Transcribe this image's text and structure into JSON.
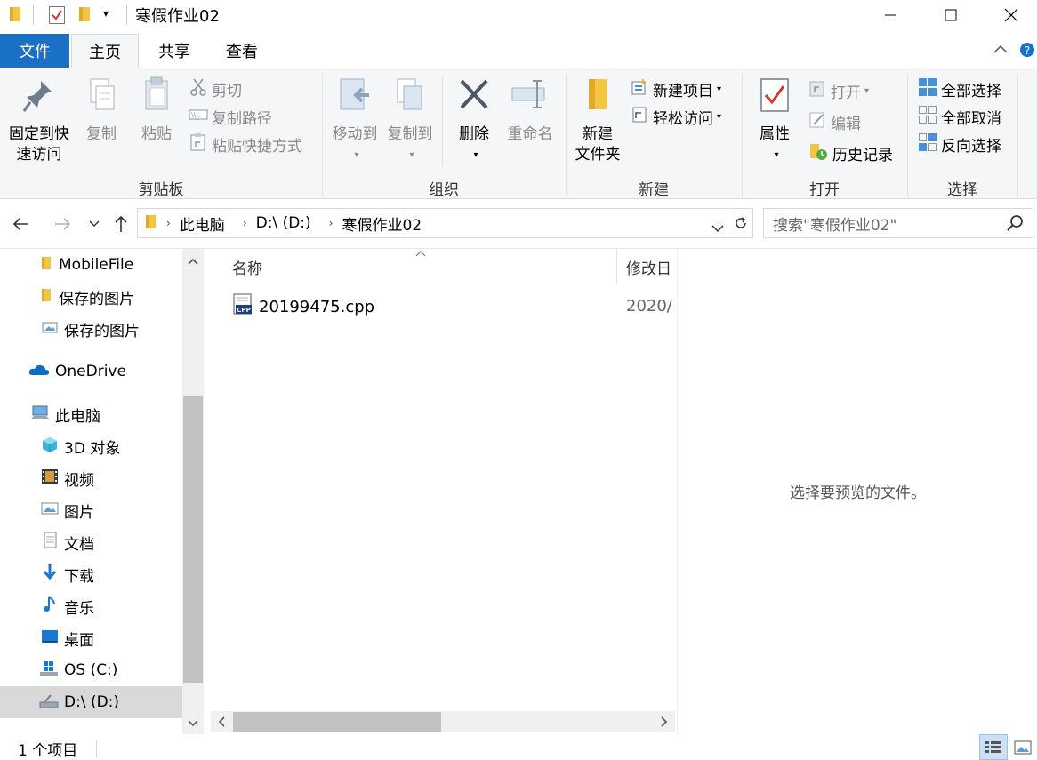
{
  "window": {
    "title": "寒假作业02",
    "controls": {
      "minimize": "—",
      "maximize": "☐",
      "close": "✕"
    }
  },
  "ribbon_tabs": [
    {
      "label": "文件"
    },
    {
      "label": "主页"
    },
    {
      "label": "共享"
    },
    {
      "label": "查看"
    }
  ],
  "ribbon": {
    "clipboard": {
      "group_label": "剪贴板",
      "pin_line1": "固定到快",
      "pin_line2": "速访问",
      "copy": "复制",
      "paste": "粘贴",
      "cut": "剪切",
      "copy_path": "复制路径",
      "paste_shortcut": "粘贴快捷方式"
    },
    "organize": {
      "group_label": "组织",
      "move_to": "移动到",
      "copy_to": "复制到",
      "delete": "删除",
      "rename": "重命名"
    },
    "new": {
      "group_label": "新建",
      "new_folder_line1": "新建",
      "new_folder_line2": "文件夹",
      "new_item": "新建项目",
      "easy_access": "轻松访问"
    },
    "open": {
      "group_label": "打开",
      "properties": "属性",
      "open": "打开",
      "edit": "编辑",
      "history": "历史记录"
    },
    "select": {
      "group_label": "选择",
      "select_all": "全部选择",
      "select_none": "全部取消",
      "invert": "反向选择"
    }
  },
  "address": {
    "segments": [
      "此电脑",
      "D:\\ (D:)",
      "寒假作业02"
    ],
    "search_placeholder": "搜索\"寒假作业02\""
  },
  "nav_pane": {
    "items": [
      {
        "label": "MobileFile"
      },
      {
        "label": "保存的图片"
      },
      {
        "label": "保存的图片"
      },
      {
        "label": "OneDrive"
      },
      {
        "label": "此电脑"
      },
      {
        "label": "3D 对象"
      },
      {
        "label": "视频"
      },
      {
        "label": "图片"
      },
      {
        "label": "文档"
      },
      {
        "label": "下载"
      },
      {
        "label": "音乐"
      },
      {
        "label": "桌面"
      },
      {
        "label": "OS (C:)"
      },
      {
        "label": "D:\\ (D:)"
      }
    ]
  },
  "file_list": {
    "columns": [
      "名称",
      "修改日"
    ],
    "files": [
      {
        "name": "20199475.cpp",
        "modified": "2020/"
      }
    ]
  },
  "preview": {
    "message": "选择要预览的文件。"
  },
  "status": {
    "item_count": "1 个项目"
  },
  "colors": {
    "accent": "#1a6fc7",
    "selected_bg": "#d9d9d9",
    "folder": "#f4c542"
  }
}
